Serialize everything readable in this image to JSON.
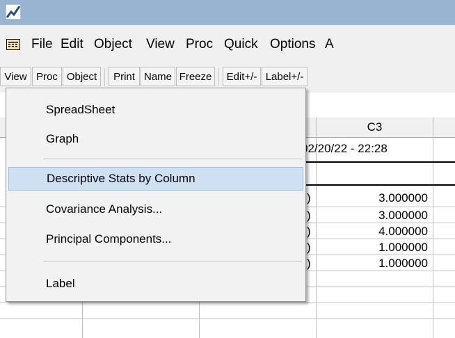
{
  "titlebar": {
    "icon": "chart-app-icon",
    "bg_color": "#99b4d1"
  },
  "menubar": {
    "items": [
      "File",
      "Edit",
      "Object",
      "View",
      "Proc",
      "Quick",
      "Options",
      "A"
    ]
  },
  "toolbar": {
    "buttons": [
      "View",
      "Proc",
      "Object",
      "Print",
      "Name",
      "Freeze",
      "Edit+/-",
      "Label+/-"
    ]
  },
  "sheet": {
    "column_header": "C3",
    "date_text": "02/20/22 - 22:28",
    "values": [
      "3.000000",
      "3.000000",
      "4.000000",
      "1.000000",
      "1.000000"
    ]
  },
  "context_menu": {
    "items": [
      "SpreadSheet",
      "Graph",
      "Descriptive Stats by Column",
      "Covariance Analysis...",
      "Principal Components...",
      "Label"
    ],
    "highlight_color": "#cfe0f3"
  }
}
